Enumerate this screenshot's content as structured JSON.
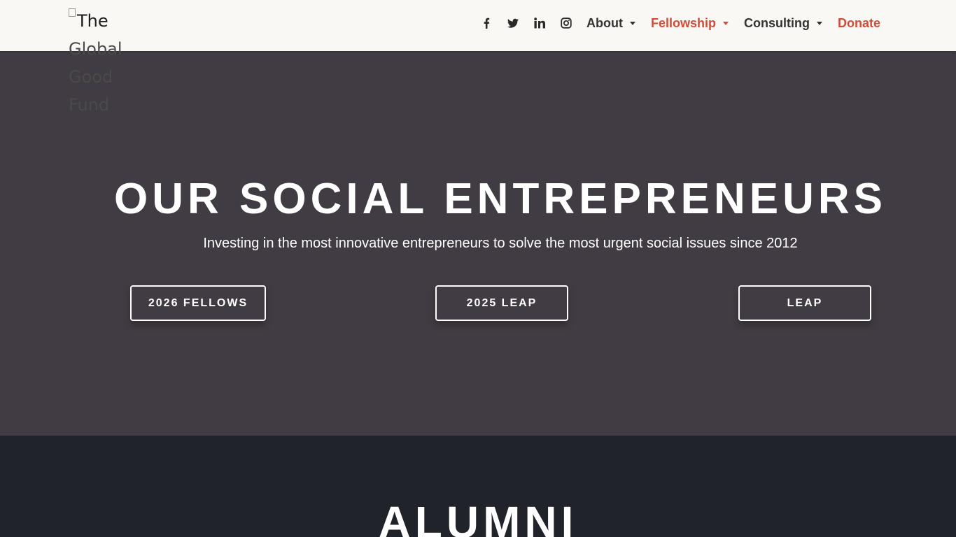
{
  "header": {
    "logo_alt_words": [
      "The",
      "Global",
      "Good",
      "Fund"
    ],
    "social": [
      {
        "name": "facebook-icon"
      },
      {
        "name": "twitter-icon"
      },
      {
        "name": "linkedin-icon"
      },
      {
        "name": "instagram-icon"
      }
    ],
    "menu": {
      "about": "About",
      "fellowship": "Fellowship",
      "consulting": "Consulting",
      "donate": "Donate"
    },
    "colors": {
      "accent": "#d64b38",
      "header_bg": "#f9f8f5"
    }
  },
  "hero": {
    "title": "OUR SOCIAL ENTREPRENEURS",
    "subtitle": "Investing in the most innovative entrepreneurs to solve the most urgent social issues since 2012",
    "buttons": {
      "fellows": "2026 FELLOWS",
      "leap_2025": "2025 LEAP",
      "leap": "LEAP"
    },
    "colors": {
      "bg": "#413c43"
    }
  },
  "alumni": {
    "title": "ALUMNI",
    "colors": {
      "bg": "#21232b"
    }
  }
}
